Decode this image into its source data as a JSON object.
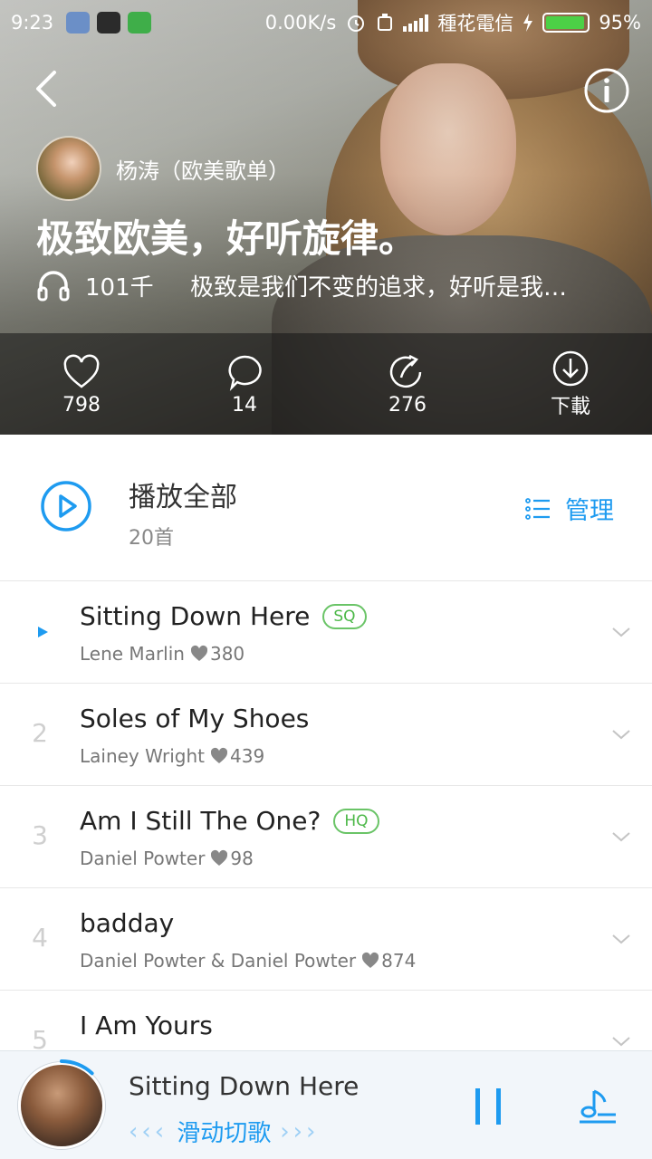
{
  "status_bar": {
    "time": "9:23",
    "net_speed": "0.00K/s",
    "carrier": "種花電信",
    "battery": "95%",
    "battery_level": 0.95
  },
  "header": {
    "creator_name": "杨涛（欧美歌单）",
    "title": "极致欧美，好听旋律。",
    "play_count": "101千",
    "description": "极致是我们不变的追求，好听是我…",
    "stats": {
      "likes": "798",
      "comments": "14",
      "shares": "276",
      "download": "下載"
    }
  },
  "play_all": {
    "label": "播放全部",
    "count": "20首",
    "manage": "管理"
  },
  "songs": [
    {
      "num": "",
      "title": "Sitting Down Here",
      "badge": "SQ",
      "artist": "Lene Marlin",
      "likes": "380",
      "playing": true
    },
    {
      "num": "2",
      "title": "Soles of My Shoes",
      "badge": "",
      "artist": "Lainey Wright",
      "likes": "439",
      "playing": false
    },
    {
      "num": "3",
      "title": "Am I Still The One?",
      "badge": "HQ",
      "artist": "Daniel Powter",
      "likes": "98",
      "playing": false
    },
    {
      "num": "4",
      "title": "badday",
      "badge": "",
      "artist": "Daniel Powter & Daniel Powter",
      "likes": "874",
      "playing": false
    },
    {
      "num": "5",
      "title": "I Am Yours",
      "badge": "",
      "artist": "",
      "likes": "",
      "playing": false
    }
  ],
  "mini_player": {
    "title": "Sitting Down Here",
    "hint": "滑动切歌",
    "arrows_left": "‹‹‹",
    "arrows_right": "›››",
    "progress": 0.12
  },
  "colors": {
    "accent": "#1e9bf0",
    "badge_green": "#4cb848",
    "battery_green": "#4cd046"
  },
  "icons": [
    "back-icon",
    "info-icon",
    "headphones-icon",
    "heart-icon",
    "comment-icon",
    "share-icon",
    "download-icon",
    "play-circle-icon",
    "list-icon",
    "chevron-down-icon",
    "pause-icon",
    "playlist-icon"
  ]
}
